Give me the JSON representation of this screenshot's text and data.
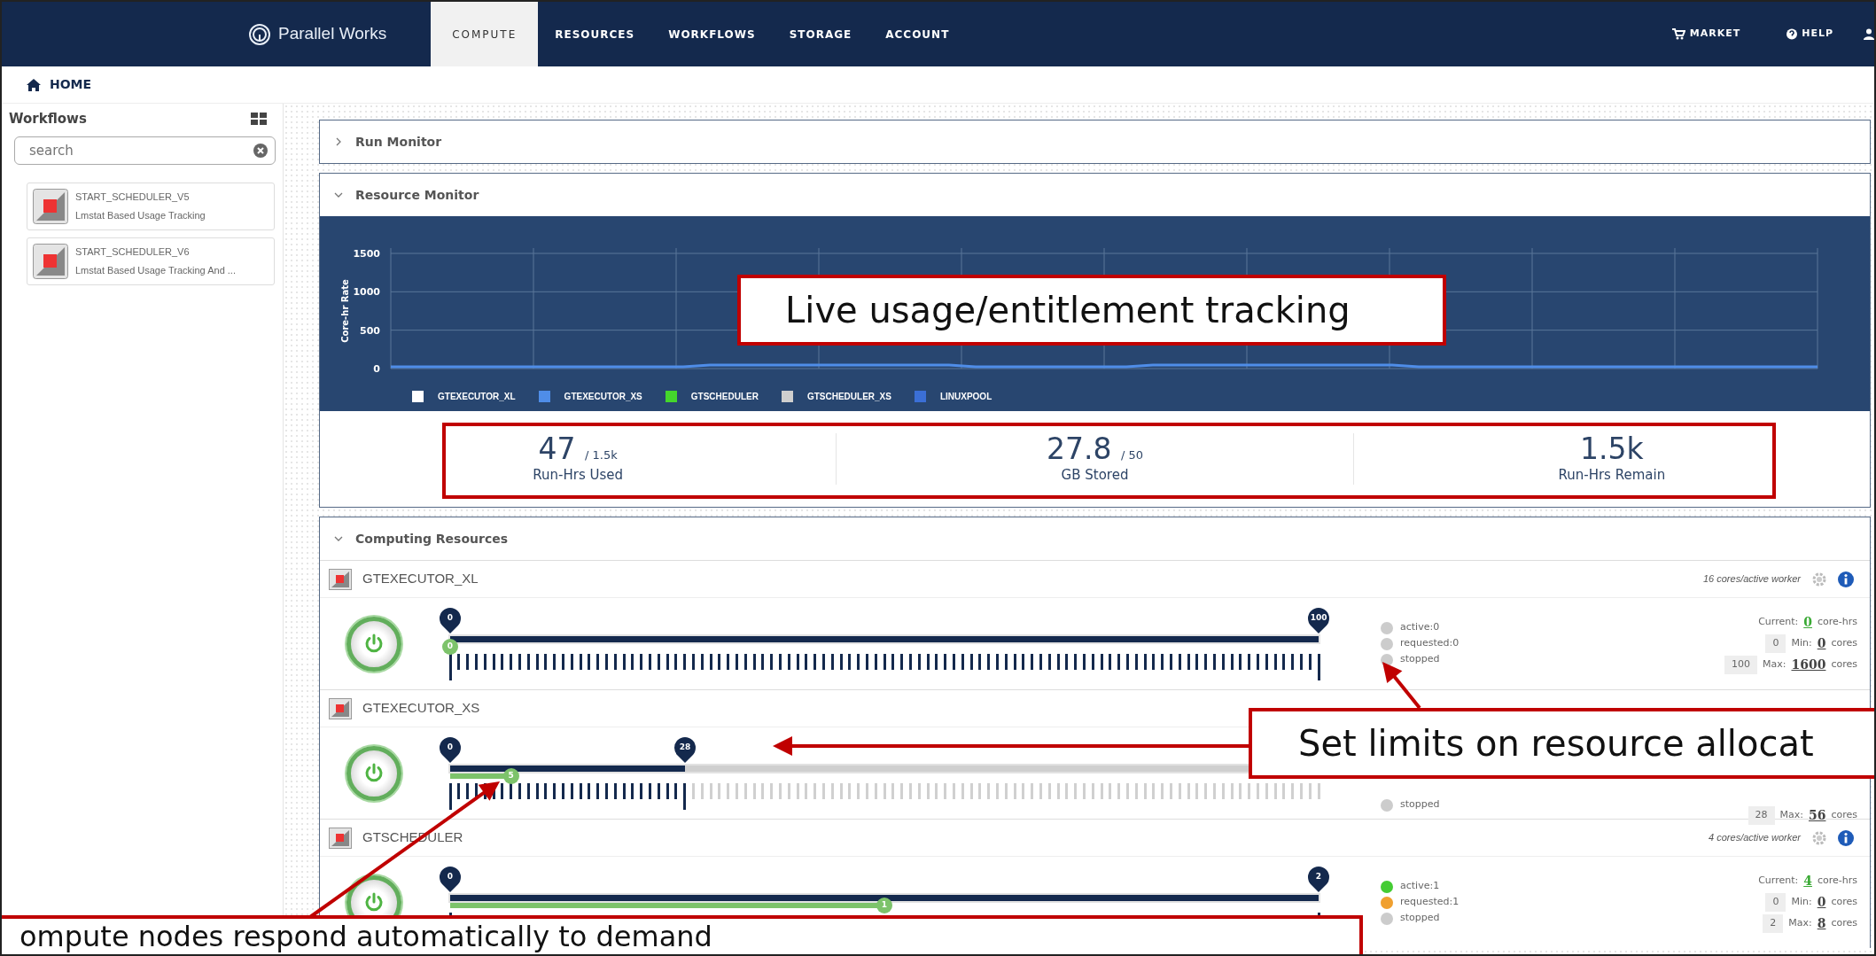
{
  "nav": {
    "logo": "Parallel Works",
    "tabs": [
      {
        "label": "COMPUTE",
        "selected": true
      },
      {
        "label": "RESOURCES",
        "selected": false
      },
      {
        "label": "WORKFLOWS",
        "selected": false
      },
      {
        "label": "STORAGE",
        "selected": false
      },
      {
        "label": "ACCOUNT",
        "selected": false
      }
    ],
    "links": [
      {
        "kind": "cart",
        "label": "MARKET"
      },
      {
        "kind": "help",
        "label": "HELP"
      },
      {
        "kind": "user"
      }
    ]
  },
  "breadcrumb": {
    "label": "HOME"
  },
  "sidebar": {
    "title": "Workflows",
    "search": {
      "placeholder": "search"
    },
    "items": [
      {
        "title": "START_SCHEDULER_V5",
        "subtitle": "Lmstat Based Usage Tracking"
      },
      {
        "title": "START_SCHEDULER_V6",
        "subtitle": "Lmstat Based Usage Tracking And ..."
      }
    ]
  },
  "panels": [
    {
      "title": "Run Monitor",
      "expanded": false
    },
    {
      "kind": "monitor",
      "title": "Resource Monitor",
      "expanded": true,
      "chart": {
        "ylabel": "Core-hr Rate",
        "yticks": [
          "1500",
          "1000",
          "500",
          "0"
        ],
        "legend": [
          {
            "label": "GTEXECUTOR_XL",
            "color": "#ffffff"
          },
          {
            "label": "GTEXECUTOR_XS",
            "color": "#4f8de8"
          },
          {
            "label": "GTSCHEDULER",
            "color": "#44d62c"
          },
          {
            "label": "GTSCHEDULER_XS",
            "color": "#cfcfcf"
          },
          {
            "label": "LINUXPOOL",
            "color": "#3b6fd6"
          }
        ]
      },
      "stats": [
        {
          "value": "47",
          "of": "/ 1.5k",
          "label": "Run-Hrs Used"
        },
        {
          "value": "27.8",
          "of": "/ 50",
          "label": "GB Stored"
        },
        {
          "value": "1.5k",
          "label": "Run-Hrs Remain"
        }
      ]
    },
    {
      "kind": "resources",
      "title": "Computing Resources",
      "expanded": true,
      "resources": [
        {
          "name": "GTEXECUTOR_XL",
          "cores_note": "16 cores/active worker",
          "slider": {
            "kind": "fine",
            "start_pin": "0",
            "limit": {
              "label": "100",
              "level": 1
            },
            "value": {
              "label": "0",
              "level": 0
            }
          },
          "status": [
            {
              "label": "active:0",
              "color": "#cccccc"
            },
            {
              "label": "requested:0",
              "color": "#cccccc"
            },
            {
              "label": "stopped",
              "color": "#cccccc"
            }
          ],
          "current": {
            "label": "Current:",
            "value": "0",
            "unit": "core-hrs"
          },
          "min": {
            "input": "0",
            "label": "Min:",
            "value": "0",
            "unit": "cores"
          },
          "max": {
            "input": "100",
            "label": "Max:",
            "value": "1600",
            "unit": "cores"
          }
        },
        {
          "name": "GTEXECUTOR_XS",
          "slider": {
            "kind": "fine",
            "start_pin": "0",
            "limit": {
              "label": "28",
              "level": 0.27
            },
            "value": {
              "label": "5",
              "level": 0.07
            }
          },
          "status": [
            {
              "label": "stopped",
              "color": "#cccccc"
            }
          ],
          "max": {
            "input": "28",
            "label": "Max:",
            "value": "56",
            "unit": "cores"
          }
        },
        {
          "name": "GTSCHEDULER",
          "cores_note": "4 cores/active worker",
          "slider": {
            "kind": "coarse",
            "start_pin": "0",
            "limit": {
              "label": "2",
              "level": 1
            },
            "value": {
              "label": "1",
              "level": 0.5
            }
          },
          "status": [
            {
              "label": "active:1",
              "color": "#44cc33"
            },
            {
              "label": "requested:1",
              "color": "#f0a030"
            },
            {
              "label": "stopped",
              "color": "#cccccc"
            }
          ],
          "current": {
            "label": "Current:",
            "value": "4",
            "unit": "core-hrs"
          },
          "min": {
            "input": "0",
            "label": "Min:",
            "value": "0",
            "unit": "cores"
          },
          "max": {
            "input": "2",
            "label": "Max:",
            "value": "8",
            "unit": "cores"
          }
        }
      ]
    }
  ],
  "callouts": [
    {
      "text": "Live usage/entitlement tracking"
    },
    {
      "text": "Set limits on resource allocat"
    },
    {
      "text": "ompute nodes respond automatically to demand"
    }
  ]
}
